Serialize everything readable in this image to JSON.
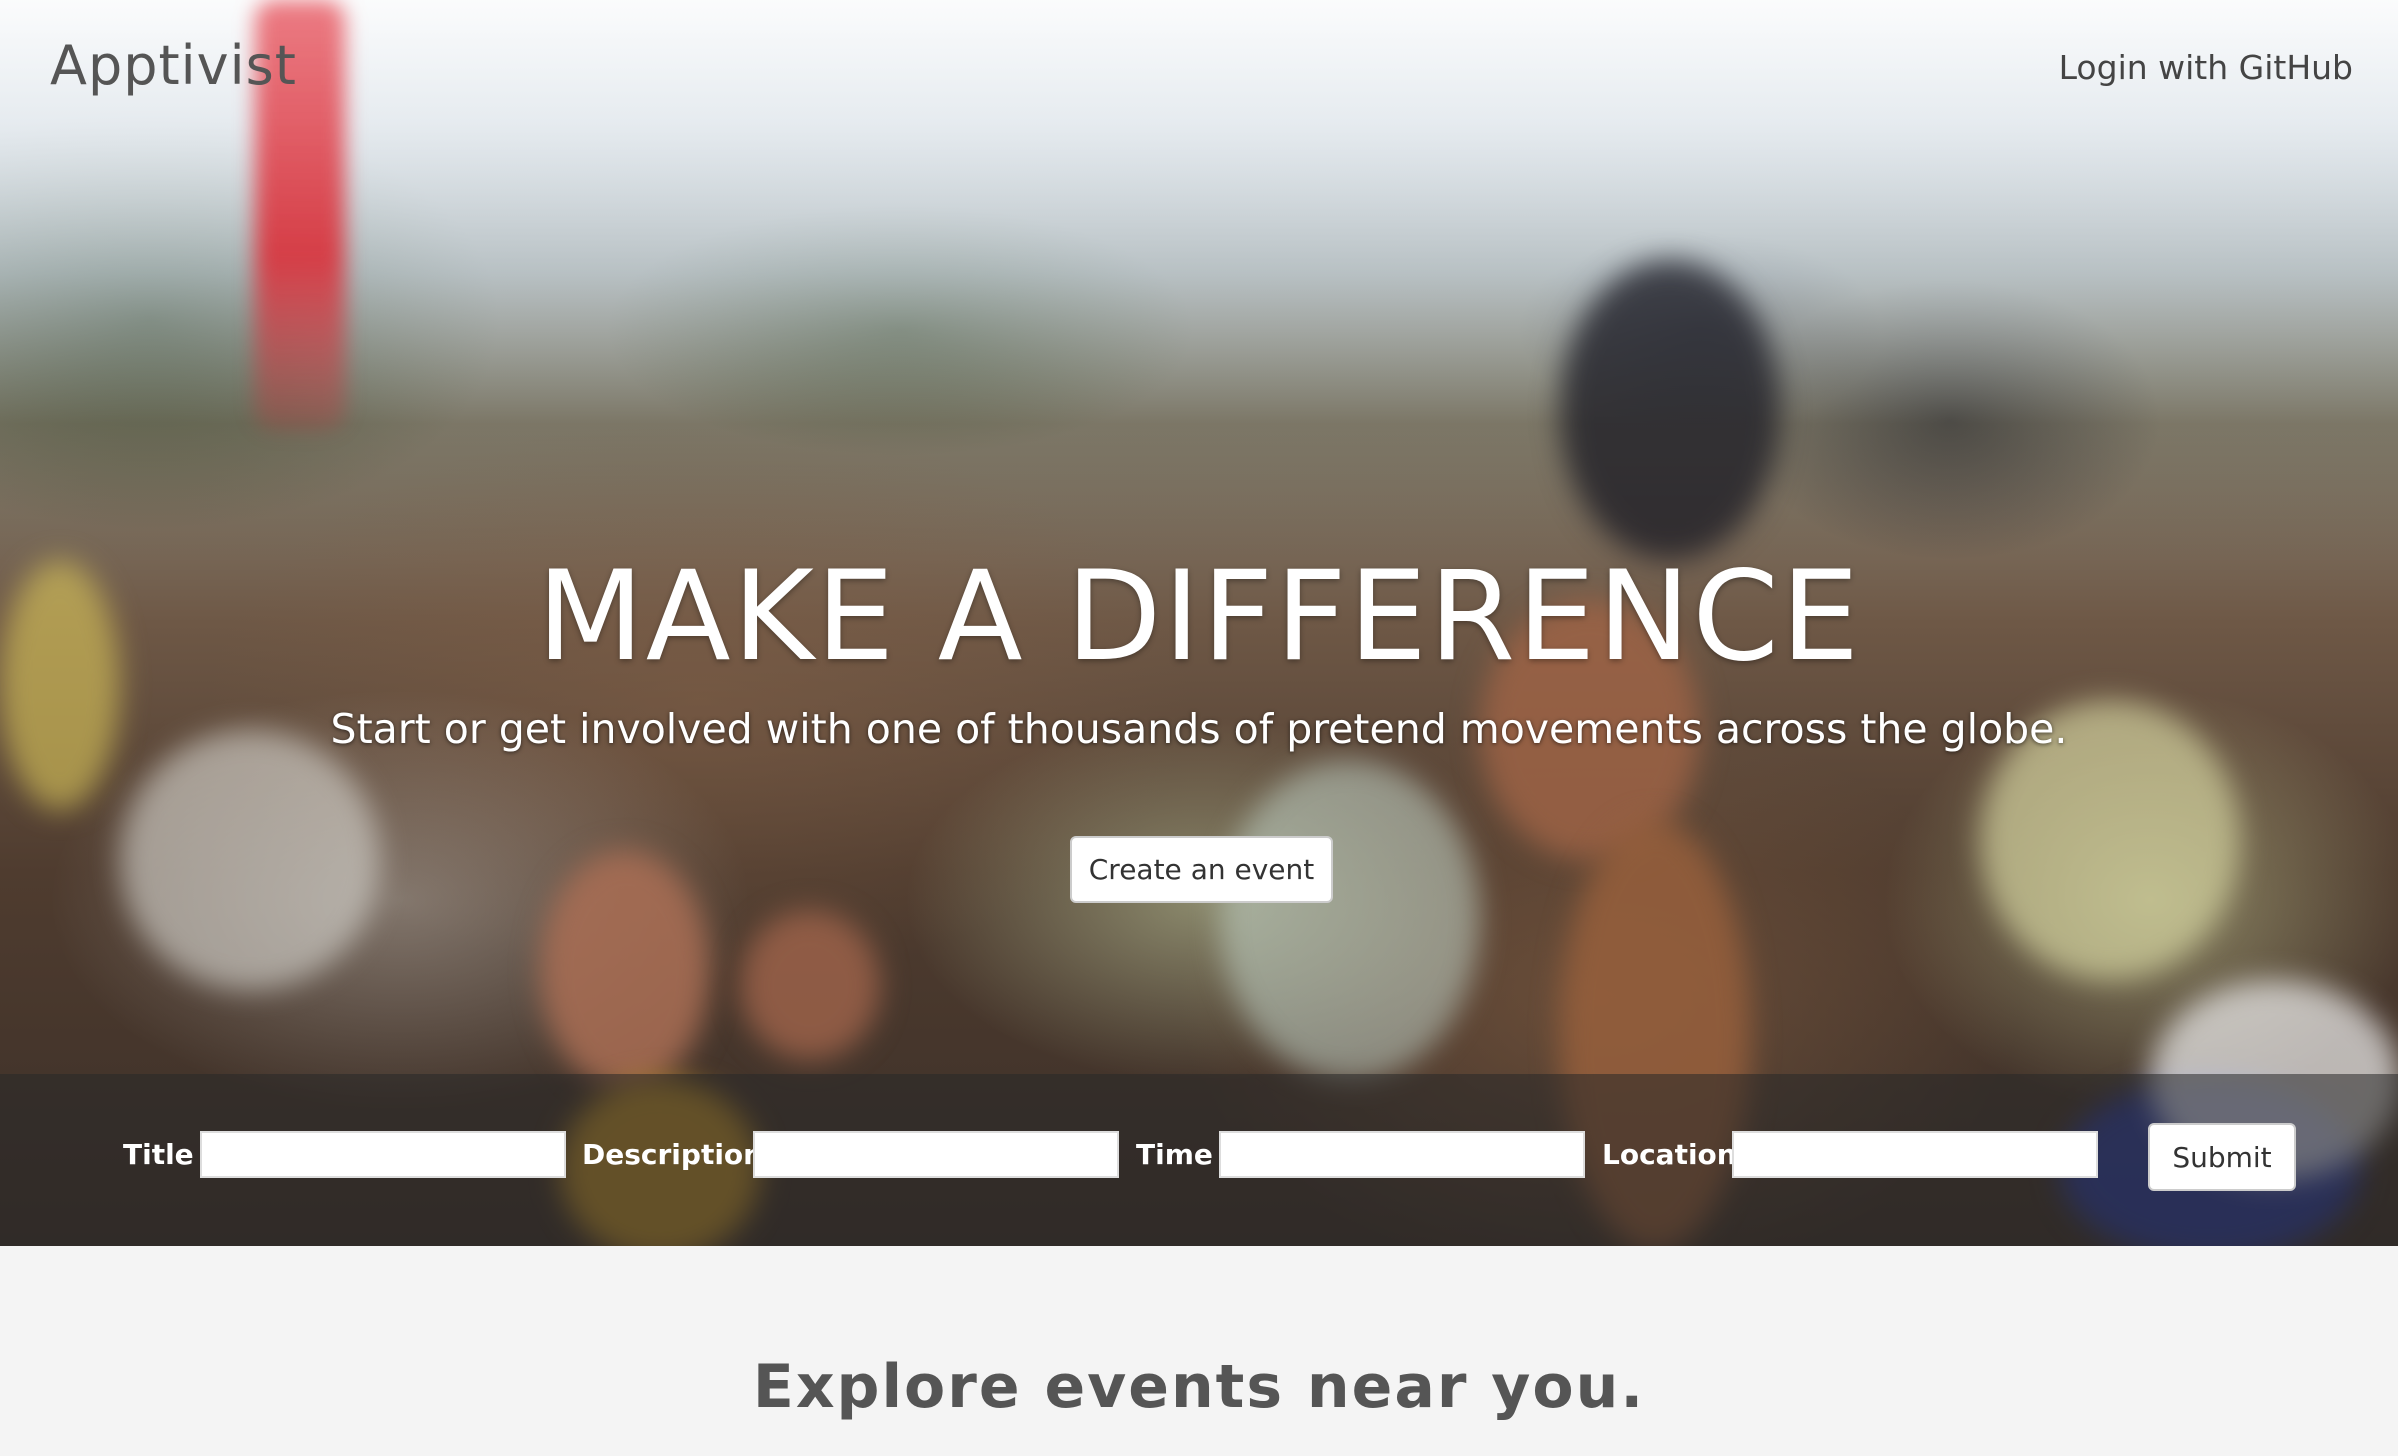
{
  "nav": {
    "brand": "Apptivist",
    "login_label": "Login with GitHub"
  },
  "hero": {
    "headline": "MAKE A DIFFERENCE",
    "subline": "Start or get involved with one of thousands of pretend movements across the globe.",
    "create_button": "Create an event"
  },
  "form": {
    "title_label": "Title",
    "title_value": "",
    "description_label": "Description",
    "description_value": "",
    "time_label": "Time",
    "time_value": "",
    "location_label": "Location",
    "location_value": "",
    "submit_label": "Submit"
  },
  "explore": {
    "heading": "Explore events near you."
  },
  "colors": {
    "hero_text": "#ffffff",
    "brand_text": "#555555",
    "page_background": "#f4f4f4"
  }
}
